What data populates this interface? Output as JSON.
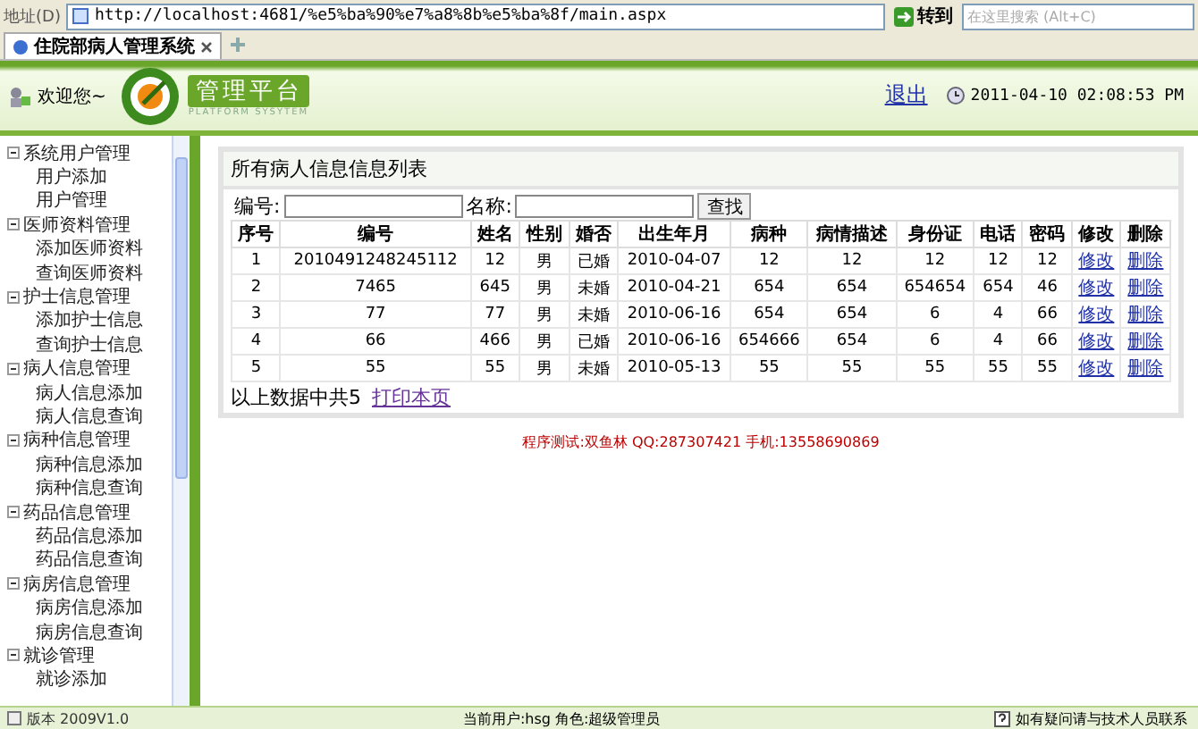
{
  "browser": {
    "address_label": "地址(D)",
    "address": "http://localhost:4681/%e5%ba%90%e7%a8%8b%e5%ba%8f/main.aspx",
    "go_button": "转到",
    "search_placeholder": "在这里搜索 (Alt+C)",
    "tab_title": "住院部病人管理系统"
  },
  "header": {
    "welcome": "欢迎您~",
    "logo_text": "管理平台",
    "logo_subtitle": "PLATFORM SYSYTEM",
    "logout": "退出",
    "datetime": "2011-04-10 02:08:53 PM"
  },
  "sidebar": {
    "items": [
      {
        "label": "系统用户管理",
        "expanded": true,
        "children": [
          {
            "label": "用户添加"
          },
          {
            "label": "用户管理"
          }
        ]
      },
      {
        "label": "医师资料管理",
        "expanded": true,
        "children": [
          {
            "label": "添加医师资料"
          },
          {
            "label": "查询医师资料"
          }
        ]
      },
      {
        "label": "护士信息管理",
        "expanded": true,
        "children": [
          {
            "label": "添加护士信息"
          },
          {
            "label": "查询护士信息"
          }
        ]
      },
      {
        "label": "病人信息管理",
        "expanded": true,
        "children": [
          {
            "label": "病人信息添加"
          },
          {
            "label": "病人信息查询"
          }
        ]
      },
      {
        "label": "病种信息管理",
        "expanded": true,
        "children": [
          {
            "label": "病种信息添加"
          },
          {
            "label": "病种信息查询"
          }
        ]
      },
      {
        "label": "药品信息管理",
        "expanded": true,
        "children": [
          {
            "label": "药品信息添加"
          },
          {
            "label": "药品信息查询"
          }
        ]
      },
      {
        "label": "病房信息管理",
        "expanded": true,
        "children": [
          {
            "label": "病房信息添加"
          },
          {
            "label": "病房信息查询"
          }
        ]
      },
      {
        "label": "就诊管理",
        "expanded": true,
        "children": [
          {
            "label": "就诊添加"
          }
        ]
      }
    ]
  },
  "content": {
    "title": "所有病人信息信息列表",
    "search": {
      "id_label": "编号:",
      "name_label": "名称:",
      "button": "查找"
    },
    "table": {
      "columns": [
        "序号",
        "编号",
        "姓名",
        "性别",
        "婚否",
        "出生年月",
        "病种",
        "病情描述",
        "身份证",
        "电话",
        "密码",
        "修改",
        "删除"
      ],
      "rows": [
        {
          "cells": [
            "1",
            "2010491248245112",
            "12",
            "男",
            "已婚",
            "2010-04-07",
            "12",
            "12",
            "12",
            "12",
            "12"
          ],
          "edit": "修改",
          "delete": "删除"
        },
        {
          "cells": [
            "2",
            "7465",
            "645",
            "男",
            "未婚",
            "2010-04-21",
            "654",
            "654",
            "654654",
            "654",
            "46"
          ],
          "edit": "修改",
          "delete": "删除"
        },
        {
          "cells": [
            "3",
            "77",
            "77",
            "男",
            "未婚",
            "2010-06-16",
            "654",
            "654",
            "6",
            "4",
            "66"
          ],
          "edit": "修改",
          "delete": "删除"
        },
        {
          "cells": [
            "4",
            "66",
            "466",
            "男",
            "已婚",
            "2010-06-16",
            "654666",
            "654",
            "6",
            "4",
            "66"
          ],
          "edit": "修改",
          "delete": "删除"
        },
        {
          "cells": [
            "5",
            "55",
            "55",
            "男",
            "未婚",
            "2010-05-13",
            "55",
            "55",
            "55",
            "55",
            "55"
          ],
          "edit": "修改",
          "delete": "删除"
        }
      ]
    },
    "summary": "以上数据中共5",
    "print_link": "打印本页"
  },
  "footer_note": "程序测试:双鱼林 QQ:287307421 手机:13558690869",
  "status_bar": {
    "version": "版本 2009V1.0",
    "user": "当前用户:hsg 角色:超级管理员",
    "help": "如有疑问请与技术人员联系"
  }
}
